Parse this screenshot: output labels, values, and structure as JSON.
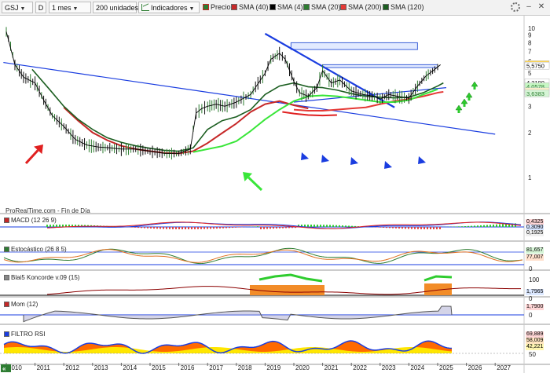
{
  "toolbar": {
    "symbol": "GSJ",
    "d_button": "D",
    "period": "1 mes",
    "units": "200 unidades",
    "indicators": "Indicadores",
    "price": "Precio",
    "sma40": "SMA (40)",
    "sma4": "SMA (4)",
    "sma20": "SMA (20)",
    "sma200": "SMA (200)",
    "sma120": "SMA (120)"
  },
  "colors": {
    "up": "#2e7d32",
    "down": "#c62828",
    "sma4": "#000000",
    "sma20": "#2e7d32",
    "sma200": "#e53935",
    "sma120": "#1b5e20",
    "sma40": "#c62828",
    "trend_blue": "#1a3de0",
    "ma_light_green": "#39e639",
    "ma_red": "#e02020"
  },
  "chart_data": {
    "type": "line",
    "title": "",
    "price_axis": [
      "10",
      "9",
      "8",
      "7",
      "6",
      "5",
      "4",
      "3",
      "2",
      "1"
    ],
    "x_years": [
      "2010",
      "2011",
      "2012",
      "2013",
      "2014",
      "2015",
      "2016",
      "2017",
      "2018",
      "2019",
      "2020",
      "2021",
      "2022",
      "2023",
      "2024",
      "2025",
      "2026",
      "2027"
    ],
    "price_labels": [
      "5,70",
      "5,5750",
      "4,3190",
      "4,0578",
      "3,7532",
      "3,6383"
    ],
    "price_series": {
      "x": [
        2010.0,
        2010.3,
        2010.6,
        2011.0,
        2011.3,
        2011.6,
        2012.0,
        2012.4,
        2012.8,
        2013.2,
        2013.6,
        2014.0,
        2014.5,
        2015.0,
        2015.5,
        2016.0,
        2016.4,
        2016.6,
        2016.8,
        2017.0,
        2017.3,
        2017.6,
        2018.0,
        2018.5,
        2019.0,
        2019.2,
        2019.5,
        2019.7,
        2020.0,
        2020.2,
        2020.5,
        2020.8,
        2021.0,
        2021.3,
        2021.6,
        2022.0,
        2022.4,
        2022.8,
        2023.0,
        2023.3,
        2023.6,
        2024.0,
        2024.3,
        2024.6,
        2024.9,
        2025.1
      ],
      "y": [
        9.5,
        5.7,
        4.7,
        4.3,
        3.3,
        2.6,
        2.2,
        1.8,
        1.65,
        1.6,
        1.58,
        1.55,
        1.55,
        1.5,
        1.45,
        1.45,
        1.55,
        2.7,
        2.9,
        3.0,
        3.1,
        3.0,
        3.2,
        3.6,
        5.0,
        6.2,
        6.8,
        6.2,
        4.4,
        3.7,
        3.5,
        4.0,
        5.2,
        4.3,
        4.5,
        3.8,
        3.6,
        3.5,
        3.35,
        3.6,
        3.5,
        3.4,
        4.1,
        4.8,
        5.3,
        5.7
      ]
    },
    "sma40_series": {
      "x": [
        2012.0,
        2012.5,
        2013.0,
        2013.5,
        2014.0,
        2014.5,
        2015.0,
        2015.5,
        2016.0,
        2016.5,
        2017.0,
        2017.5,
        2018.0,
        2018.5,
        2019.0,
        2019.5,
        2020.0,
        2020.5
      ],
      "y": [
        2.95,
        2.4,
        2.0,
        1.78,
        1.63,
        1.55,
        1.5,
        1.46,
        1.45,
        1.5,
        1.7,
        1.98,
        2.3,
        2.75,
        3.1,
        3.25,
        3.05,
        2.9
      ]
    },
    "sma120_series": {
      "x": [
        2010.9,
        2011.5,
        2012.0,
        2012.5,
        2013.0,
        2013.5,
        2014.0,
        2014.5,
        2015.0,
        2015.5,
        2016.0,
        2016.5,
        2017.0,
        2017.5,
        2018.0,
        2018.5,
        2019.0,
        2019.5,
        2020.0,
        2020.5,
        2021.0,
        2021.5,
        2022.0,
        2022.5,
        2023.0,
        2023.5,
        2024.0,
        2024.5,
        2025.0,
        2025.2
      ],
      "y": [
        5.3,
        3.9,
        3.0,
        2.45,
        2.1,
        1.85,
        1.72,
        1.63,
        1.57,
        1.52,
        1.5,
        1.58,
        2.1,
        2.4,
        2.55,
        2.85,
        3.6,
        4.1,
        4.3,
        4.05,
        4.0,
        3.85,
        3.65,
        3.5,
        3.45,
        3.42,
        3.45,
        3.7,
        4.1,
        4.3
      ]
    },
    "sma200_series": {
      "x": [
        2020.0,
        2020.5,
        2021.0,
        2021.5,
        2022.0,
        2022.5,
        2023.0,
        2023.5,
        2024.0,
        2024.5,
        2025.0,
        2025.2
      ],
      "y": [
        2.85,
        2.8,
        2.8,
        2.85,
        2.9,
        2.95,
        3.1,
        3.25,
        3.35,
        3.5,
        3.7,
        3.75
      ]
    },
    "sma_green_series": {
      "x": [
        2016.5,
        2017.0,
        2017.5,
        2018.0,
        2018.5,
        2019.0,
        2019.5,
        2020.0,
        2020.5,
        2021.0,
        2021.5,
        2022.0,
        2022.5,
        2023.0,
        2023.5,
        2024.0,
        2024.5,
        2025.0
      ],
      "y": [
        1.48,
        1.55,
        1.62,
        1.75,
        2.05,
        2.45,
        2.85,
        3.25,
        3.5,
        3.55,
        3.5,
        3.4,
        3.3,
        3.2,
        3.2,
        3.3,
        3.6,
        3.9
      ]
    },
    "lower_red_series": {
      "x": [
        2019.6,
        2020.0,
        2020.5,
        2021.0,
        2021.5
      ],
      "y": [
        2.75,
        2.68,
        2.62,
        2.6,
        2.62
      ]
    },
    "trendlines": [
      {
        "from": [
          2009.9,
          5.9
        ],
        "to": [
          2027.0,
          1.95
        ]
      },
      {
        "from": [
          2019.0,
          9.2
        ],
        "to": [
          2023.5,
          2.95
        ]
      },
      {
        "from": [
          2020.0,
          3.2
        ],
        "to": [
          2025.3,
          4.0
        ]
      }
    ],
    "target_boxes": [
      {
        "x": [
          2019.9,
          2024.3
        ],
        "y": [
          7.2,
          8.0
        ]
      },
      {
        "x": [
          2021.0,
          2025.0
        ],
        "y": [
          5.45,
          5.7
        ]
      }
    ]
  },
  "panels": {
    "source": "ProRealTime.com - Fin de Día",
    "macd": {
      "label": "MACD (12 26 9)",
      "tags": [
        "0,4325",
        "0,3090",
        "0,1925"
      ],
      "tag_colors": [
        "#ffd6d6",
        "#d6e4ff",
        "#f0f0f0"
      ]
    },
    "stoch": {
      "label": "Estocástico (26 8 5)",
      "tags": [
        "81,657",
        "77,007"
      ],
      "tag_colors": [
        "#d6f5d6",
        "#ffe0cc"
      ],
      "axis": [
        "0"
      ]
    },
    "blai5": {
      "label": "Blai5 Koncorde v.09 (15)",
      "tags": [
        "1,7965"
      ],
      "tag_colors": [
        "#dce8ff"
      ],
      "axis": [
        "100",
        "0"
      ]
    },
    "mom": {
      "label": "Mom (12)",
      "tags": [
        "1,7900"
      ],
      "tag_colors": [
        "#ffd6d6"
      ],
      "axis": [
        "0"
      ]
    },
    "rsi": {
      "label": "FILTRO RSI",
      "tags": [
        "69,889",
        "58,009",
        "42,221"
      ],
      "tag_colors": [
        "#ffd6d6",
        "#ffe5c0",
        "#fff7b0"
      ],
      "axis": [
        "50"
      ]
    }
  }
}
